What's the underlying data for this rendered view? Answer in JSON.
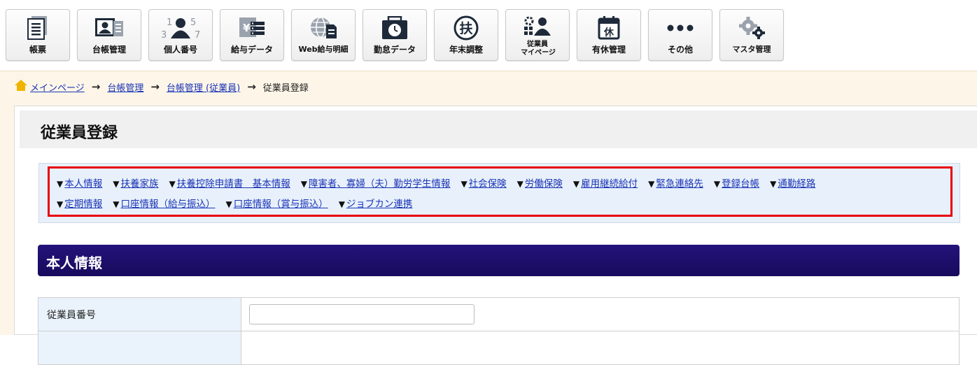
{
  "toolbar": {
    "buttons": [
      {
        "label": "帳票",
        "icon": "report-icon"
      },
      {
        "label": "台帳管理",
        "icon": "ledger-icon"
      },
      {
        "label": "個人番号",
        "icon": "my-number-icon"
      },
      {
        "label": "給与データ",
        "icon": "salary-data-icon"
      },
      {
        "label": "Web給与明細",
        "icon": "web-payslip-icon"
      },
      {
        "label": "勤怠データ",
        "icon": "attendance-icon"
      },
      {
        "label": "年末調整",
        "icon": "year-end-adjustment-icon"
      },
      {
        "label": "従業員マイページ",
        "icon_text": "従業員",
        "icon": "employee-mypage-icon"
      },
      {
        "label": "有休管理",
        "icon_text": "休",
        "icon": "paid-leave-icon"
      },
      {
        "label": "その他",
        "icon": "more-icon"
      },
      {
        "label": "マスタ管理",
        "icon": "master-settings-icon"
      }
    ],
    "year_end_glyph": "扶",
    "number_glyphs": [
      "1",
      "5",
      "3",
      "7"
    ],
    "yen_glyph": "¥"
  },
  "breadcrumb": {
    "items": [
      "メインページ",
      "台帳管理",
      "台帳管理 (従業員)"
    ],
    "current": "従業員登録"
  },
  "page": {
    "title": "従業員登録"
  },
  "section_nav": {
    "row1": [
      "本人情報",
      "扶養家族",
      "扶養控除申請書　基本情報",
      "障害者、寡婦（夫）勤労学生情報",
      "社会保険",
      "労働保険",
      "雇用継続給付",
      "緊急連絡先",
      "登録台帳",
      "通勤経路"
    ],
    "row2": [
      "定期情報",
      "口座情報（給与振込）",
      "口座情報（賞与振込）",
      "ジョブカン連携"
    ],
    "marker": "▼"
  },
  "section": {
    "title": "本人情報",
    "fields": [
      {
        "label": "従業員番号",
        "value": "",
        "placeholder": ""
      },
      {
        "label": "",
        "value": "",
        "placeholder": ""
      }
    ]
  },
  "colors": {
    "section_header": "#1c0f6b",
    "link": "#1a33b5",
    "highlight_frame": "#e8000b",
    "page_background": "#fdf6e8",
    "nav_background": "#e8f1fb"
  }
}
